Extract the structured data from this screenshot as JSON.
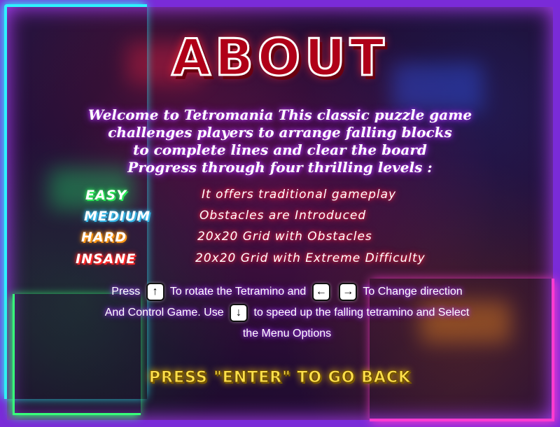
{
  "screen": {
    "title": "ABOUT",
    "intro_lines": [
      "Welcome to Tetromania This classic puzzle game",
      "challenges players  to arrange falling blocks",
      "to complete lines and clear the board",
      "Progress through four thrilling levels  :"
    ],
    "levels": [
      {
        "name": "EASY",
        "color": "#2ee85a",
        "description": "It offers traditional gameplay"
      },
      {
        "name": "MEDIUM",
        "color": "#3ab8e8",
        "description": "Obstacles are Introduced"
      },
      {
        "name": "HARD",
        "color": "#ff9a1a",
        "description": "20x20 Grid with Obstacles"
      },
      {
        "name": "INSANE",
        "color": "#ff2a2a",
        "description": "20x20 Grid with Extreme Difficulty"
      }
    ],
    "controls": {
      "part1": "Press",
      "part2": "To rotate the Tetramino and",
      "part3": "To Change direction",
      "part4": "And Control Game. Use",
      "part5": "to speed up the falling tetramino and Select",
      "part6": "the Menu Options",
      "key_up": "↑",
      "key_left": "←",
      "key_right": "→",
      "key_down": "↓"
    },
    "footer": "PRESS \"ENTER\" TO GO BACK"
  }
}
